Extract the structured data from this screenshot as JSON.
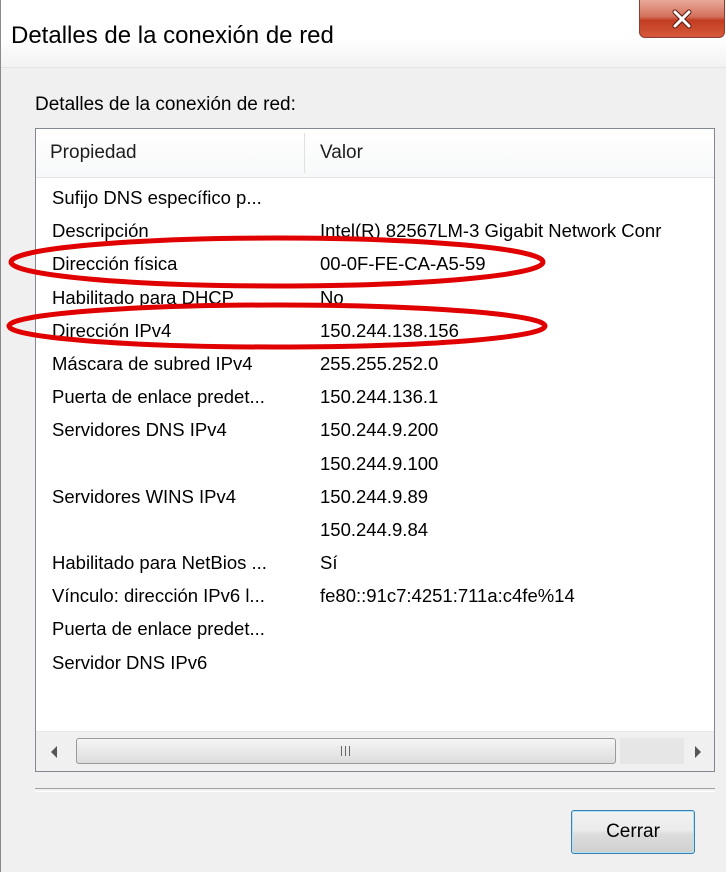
{
  "window": {
    "title": "Detalles de la conexión de red",
    "close_icon": "close-icon"
  },
  "group_label": "Detalles de la conexión de red:",
  "list": {
    "columns": [
      "Propiedad",
      "Valor"
    ],
    "rows": [
      {
        "property": "Sufijo DNS específico p...",
        "value": ""
      },
      {
        "property": "Descripción",
        "value": "Intel(R) 82567LM-3 Gigabit Network Conr"
      },
      {
        "property": "Dirección física",
        "value": "00-0F-FE-CA-A5-59"
      },
      {
        "property": "Habilitado para DHCP",
        "value": "No"
      },
      {
        "property": "Dirección IPv4",
        "value": "150.244.138.156"
      },
      {
        "property": "Máscara de subred IPv4",
        "value": "255.255.252.0"
      },
      {
        "property": "Puerta de enlace predet...",
        "value": "150.244.136.1"
      },
      {
        "property": "Servidores DNS IPv4",
        "value": "150.244.9.200"
      },
      {
        "property": "",
        "value": "150.244.9.100"
      },
      {
        "property": "Servidores WINS IPv4",
        "value": "150.244.9.89"
      },
      {
        "property": "",
        "value": "150.244.9.84"
      },
      {
        "property": "Habilitado para NetBios ...",
        "value": "Sí"
      },
      {
        "property": "Vínculo: dirección IPv6 l...",
        "value": "fe80::91c7:4251:711a:c4fe%14"
      },
      {
        "property": "Puerta de enlace predet...",
        "value": ""
      },
      {
        "property": "Servidor DNS IPv6",
        "value": ""
      }
    ]
  },
  "scrollbar": {
    "left_arrow_icon": "scroll-left-arrow-icon",
    "right_arrow_icon": "scroll-right-arrow-icon"
  },
  "buttons": {
    "close_label": "Cerrar"
  },
  "colors": {
    "annotation": "#e00000",
    "close_button": "#c23d22",
    "default_button_border": "#3c7fb1"
  }
}
